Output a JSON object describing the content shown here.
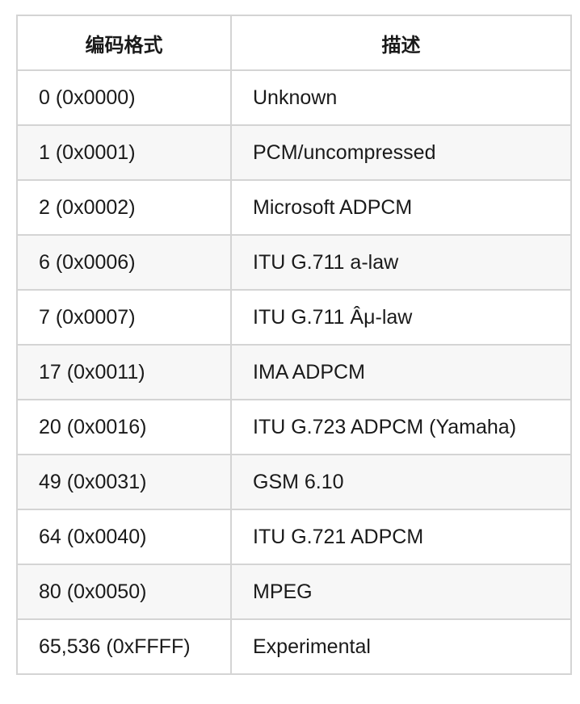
{
  "table": {
    "headers": [
      "编码格式",
      "描述"
    ],
    "rows": [
      {
        "code": "0 (0x0000)",
        "desc": "Unknown"
      },
      {
        "code": "1 (0x0001)",
        "desc": "PCM/uncompressed"
      },
      {
        "code": "2 (0x0002)",
        "desc": "Microsoft ADPCM"
      },
      {
        "code": "6 (0x0006)",
        "desc": "ITU G.711 a-law"
      },
      {
        "code": "7 (0x0007)",
        "desc": "ITU G.711 Âμ-law"
      },
      {
        "code": "17 (0x0011)",
        "desc": "IMA ADPCM"
      },
      {
        "code": "20 (0x0016)",
        "desc": "ITU G.723 ADPCM (Yamaha)"
      },
      {
        "code": "49 (0x0031)",
        "desc": "GSM 6.10"
      },
      {
        "code": "64 (0x0040)",
        "desc": "ITU G.721 ADPCM"
      },
      {
        "code": "80 (0x0050)",
        "desc": "MPEG"
      },
      {
        "code": "65,536 (0xFFFF)",
        "desc": "Experimental"
      }
    ]
  }
}
